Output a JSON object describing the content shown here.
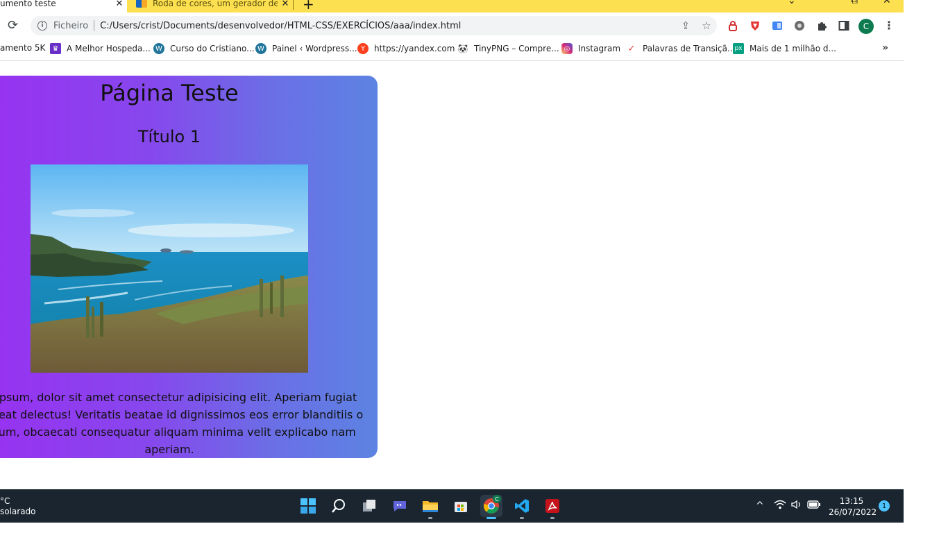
{
  "browser": {
    "tabs": [
      {
        "title": "umento teste",
        "active": true
      },
      {
        "title": "Roda de cores, um gerador de pa",
        "active": false
      }
    ],
    "tab_close": "✕",
    "new_tab": "+",
    "window_controls": {
      "minimize": "⌄",
      "restore": "⧉",
      "close": "✕"
    },
    "omnibox": {
      "info_label": "i",
      "scheme_label": "Ficheiro",
      "url": "C:/Users/crist/Documents/desenvolvedor/HTML-CSS/EXERCÍCIOS/aaa/index.html",
      "share_icon": "⇪",
      "star_icon": "☆"
    },
    "profile_initial": "C",
    "bookmarks": [
      {
        "label": "amento 5K",
        "icon": "bookmark-icon",
        "color": "#4a4a4a"
      },
      {
        "label": "A Melhor Hospeda...",
        "icon": "crown-icon",
        "color": "#6a2fc9"
      },
      {
        "label": "Curso do Cristiano...",
        "icon": "wordpress-icon",
        "color": "#21759b"
      },
      {
        "label": "Painel ‹ Wordpress...",
        "icon": "wordpress-icon",
        "color": "#21759b"
      },
      {
        "label": "https://yandex.com",
        "icon": "yandex-icon",
        "color": "#fc3f1d"
      },
      {
        "label": "TinyPNG – Compre...",
        "icon": "panda-icon",
        "color": "#333333"
      },
      {
        "label": "Instagram",
        "icon": "instagram-icon",
        "color": "#d62976"
      },
      {
        "label": "Palavras de Transiçã...",
        "icon": "check-mark-icon",
        "color": "#e53935"
      },
      {
        "label": "Mais de 1 milhão d...",
        "icon": "pexels-icon",
        "color": "#05a081"
      }
    ],
    "bookmarks_more": "»"
  },
  "page": {
    "heading": "Página Teste",
    "subheading": "Título 1",
    "paragraph": "m ipsum, dolor sit amet consectetur adipisicing elit. Aperiam fugiat placeat delectus! Veritatis beatae id dignissimos eos error blanditiis o rerum, obcaecati consequatur aliquam minima velit explicabo nam aperiam."
  },
  "taskbar": {
    "weather_temp": "°C",
    "weather_desc": "solarado",
    "chrome_badge": "C",
    "time": "13:15",
    "date": "26/07/2022",
    "notification_count": "1"
  }
}
